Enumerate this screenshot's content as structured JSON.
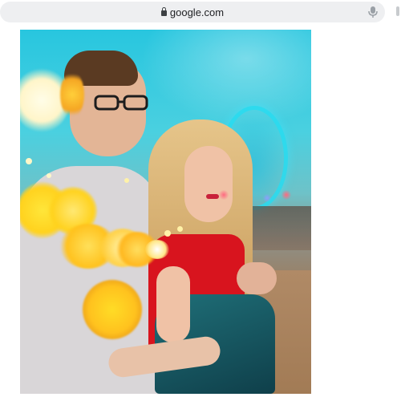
{
  "browser": {
    "url": "google.com",
    "icons": {
      "lock": "lock-icon",
      "mic": "microphone-icon"
    },
    "colors": {
      "bar": "#eeeff1",
      "text": "#202124"
    }
  },
  "content": {
    "photo": "couple-bokeh-photo",
    "colors": {
      "sky": "#28c6df",
      "bokeh": "#ffd21e",
      "dress": "#d8141e",
      "jacket": "#1f6f78"
    }
  }
}
